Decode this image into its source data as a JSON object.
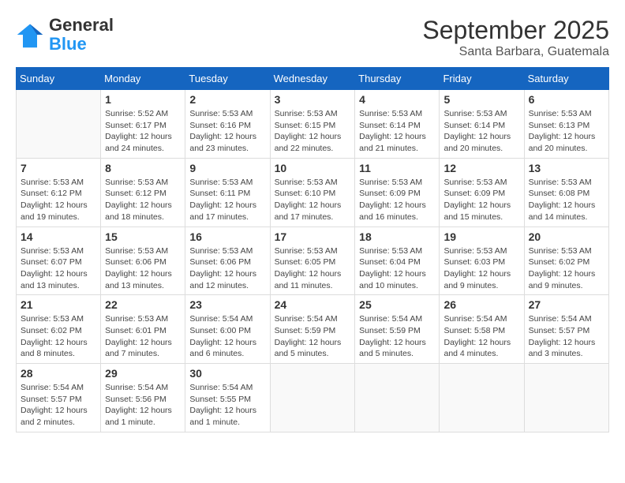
{
  "logo": {
    "general": "General",
    "blue": "Blue"
  },
  "title": "September 2025",
  "subtitle": "Santa Barbara, Guatemala",
  "days_of_week": [
    "Sunday",
    "Monday",
    "Tuesday",
    "Wednesday",
    "Thursday",
    "Friday",
    "Saturday"
  ],
  "weeks": [
    [
      {
        "day": "",
        "info": ""
      },
      {
        "day": "1",
        "info": "Sunrise: 5:52 AM\nSunset: 6:17 PM\nDaylight: 12 hours\nand 24 minutes."
      },
      {
        "day": "2",
        "info": "Sunrise: 5:53 AM\nSunset: 6:16 PM\nDaylight: 12 hours\nand 23 minutes."
      },
      {
        "day": "3",
        "info": "Sunrise: 5:53 AM\nSunset: 6:15 PM\nDaylight: 12 hours\nand 22 minutes."
      },
      {
        "day": "4",
        "info": "Sunrise: 5:53 AM\nSunset: 6:14 PM\nDaylight: 12 hours\nand 21 minutes."
      },
      {
        "day": "5",
        "info": "Sunrise: 5:53 AM\nSunset: 6:14 PM\nDaylight: 12 hours\nand 20 minutes."
      },
      {
        "day": "6",
        "info": "Sunrise: 5:53 AM\nSunset: 6:13 PM\nDaylight: 12 hours\nand 20 minutes."
      }
    ],
    [
      {
        "day": "7",
        "info": "Sunrise: 5:53 AM\nSunset: 6:12 PM\nDaylight: 12 hours\nand 19 minutes."
      },
      {
        "day": "8",
        "info": "Sunrise: 5:53 AM\nSunset: 6:12 PM\nDaylight: 12 hours\nand 18 minutes."
      },
      {
        "day": "9",
        "info": "Sunrise: 5:53 AM\nSunset: 6:11 PM\nDaylight: 12 hours\nand 17 minutes."
      },
      {
        "day": "10",
        "info": "Sunrise: 5:53 AM\nSunset: 6:10 PM\nDaylight: 12 hours\nand 17 minutes."
      },
      {
        "day": "11",
        "info": "Sunrise: 5:53 AM\nSunset: 6:09 PM\nDaylight: 12 hours\nand 16 minutes."
      },
      {
        "day": "12",
        "info": "Sunrise: 5:53 AM\nSunset: 6:09 PM\nDaylight: 12 hours\nand 15 minutes."
      },
      {
        "day": "13",
        "info": "Sunrise: 5:53 AM\nSunset: 6:08 PM\nDaylight: 12 hours\nand 14 minutes."
      }
    ],
    [
      {
        "day": "14",
        "info": "Sunrise: 5:53 AM\nSunset: 6:07 PM\nDaylight: 12 hours\nand 13 minutes."
      },
      {
        "day": "15",
        "info": "Sunrise: 5:53 AM\nSunset: 6:06 PM\nDaylight: 12 hours\nand 13 minutes."
      },
      {
        "day": "16",
        "info": "Sunrise: 5:53 AM\nSunset: 6:06 PM\nDaylight: 12 hours\nand 12 minutes."
      },
      {
        "day": "17",
        "info": "Sunrise: 5:53 AM\nSunset: 6:05 PM\nDaylight: 12 hours\nand 11 minutes."
      },
      {
        "day": "18",
        "info": "Sunrise: 5:53 AM\nSunset: 6:04 PM\nDaylight: 12 hours\nand 10 minutes."
      },
      {
        "day": "19",
        "info": "Sunrise: 5:53 AM\nSunset: 6:03 PM\nDaylight: 12 hours\nand 9 minutes."
      },
      {
        "day": "20",
        "info": "Sunrise: 5:53 AM\nSunset: 6:02 PM\nDaylight: 12 hours\nand 9 minutes."
      }
    ],
    [
      {
        "day": "21",
        "info": "Sunrise: 5:53 AM\nSunset: 6:02 PM\nDaylight: 12 hours\nand 8 minutes."
      },
      {
        "day": "22",
        "info": "Sunrise: 5:53 AM\nSunset: 6:01 PM\nDaylight: 12 hours\nand 7 minutes."
      },
      {
        "day": "23",
        "info": "Sunrise: 5:54 AM\nSunset: 6:00 PM\nDaylight: 12 hours\nand 6 minutes."
      },
      {
        "day": "24",
        "info": "Sunrise: 5:54 AM\nSunset: 5:59 PM\nDaylight: 12 hours\nand 5 minutes."
      },
      {
        "day": "25",
        "info": "Sunrise: 5:54 AM\nSunset: 5:59 PM\nDaylight: 12 hours\nand 5 minutes."
      },
      {
        "day": "26",
        "info": "Sunrise: 5:54 AM\nSunset: 5:58 PM\nDaylight: 12 hours\nand 4 minutes."
      },
      {
        "day": "27",
        "info": "Sunrise: 5:54 AM\nSunset: 5:57 PM\nDaylight: 12 hours\nand 3 minutes."
      }
    ],
    [
      {
        "day": "28",
        "info": "Sunrise: 5:54 AM\nSunset: 5:57 PM\nDaylight: 12 hours\nand 2 minutes."
      },
      {
        "day": "29",
        "info": "Sunrise: 5:54 AM\nSunset: 5:56 PM\nDaylight: 12 hours\nand 1 minute."
      },
      {
        "day": "30",
        "info": "Sunrise: 5:54 AM\nSunset: 5:55 PM\nDaylight: 12 hours\nand 1 minute."
      },
      {
        "day": "",
        "info": ""
      },
      {
        "day": "",
        "info": ""
      },
      {
        "day": "",
        "info": ""
      },
      {
        "day": "",
        "info": ""
      }
    ]
  ]
}
